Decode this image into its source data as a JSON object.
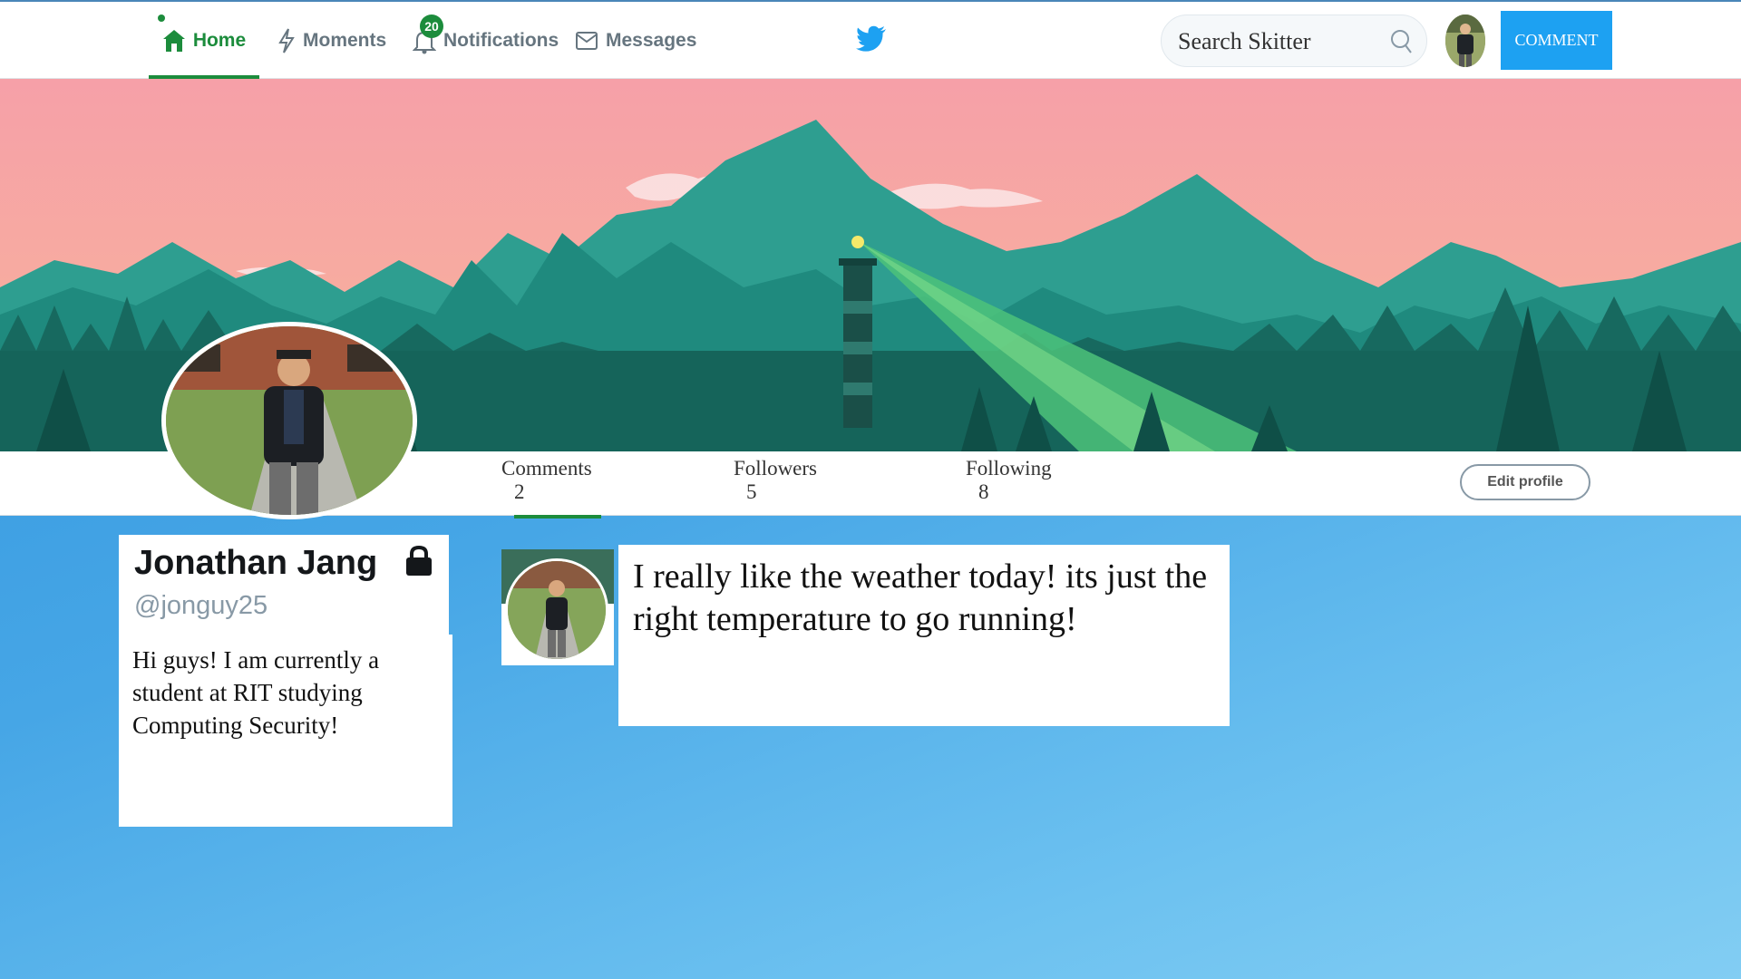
{
  "nav": {
    "home": "Home",
    "moments": "Moments",
    "notifications": "Notifications",
    "notifications_count": "20",
    "messages": "Messages"
  },
  "search": {
    "placeholder": "Search Skitter"
  },
  "comment_button": "COMMENT",
  "stats": {
    "comments_label": "Comments",
    "comments_value": "2",
    "followers_label": "Followers",
    "followers_value": "5",
    "following_label": "Following",
    "following_value": "8"
  },
  "edit_profile": "Edit profile",
  "profile": {
    "name": "Jonathan Jang",
    "handle": "@jonguy25",
    "bio": "Hi guys! I am currently a student at RIT studying Computing Security!"
  },
  "post": {
    "text": "I really like the weather today! its just the right temperature to go running!"
  },
  "colors": {
    "accent_green": "#1c8c3c",
    "brand_blue": "#1da1f2",
    "sky_pink": "#f4a3a8",
    "mountain_teal": "#1e8f82"
  },
  "icons": [
    "home-icon",
    "lightning-icon",
    "bell-icon",
    "envelope-icon",
    "bird-icon",
    "search-icon",
    "lock-icon"
  ]
}
